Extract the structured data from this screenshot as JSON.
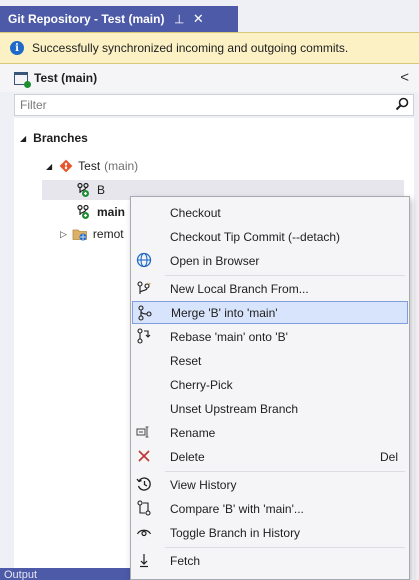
{
  "tab": {
    "title": "Git Repository - Test (main)",
    "pin": "⊣",
    "close": "✕"
  },
  "infobar": {
    "message": "Successfully synchronized incoming and outgoing commits.",
    "icon": "info-icon"
  },
  "repo": {
    "title": "Test (main)",
    "chevron": "<"
  },
  "filter": {
    "placeholder": "Filter"
  },
  "tree": {
    "branches_label": "Branches",
    "repo_node": {
      "name": "Test",
      "suffix": "(main)"
    },
    "branches": [
      {
        "name": "B"
      },
      {
        "name": "main"
      }
    ],
    "remotes_label": "remot"
  },
  "output_tab": {
    "label": "Output"
  },
  "menu": {
    "items": [
      {
        "label": "Checkout",
        "shortcut": "",
        "icon": ""
      },
      {
        "label": "Checkout Tip Commit (--detach)",
        "shortcut": "",
        "icon": ""
      },
      {
        "label": "Open in Browser",
        "shortcut": "",
        "icon": "globe-icon"
      },
      {
        "label": "New Local Branch From...",
        "shortcut": "",
        "icon": "new-branch-icon"
      },
      {
        "label": "Merge 'B' into 'main'",
        "shortcut": "",
        "icon": "merge-icon"
      },
      {
        "label": "Rebase 'main' onto 'B'",
        "shortcut": "",
        "icon": "rebase-icon"
      },
      {
        "label": "Reset",
        "shortcut": "",
        "icon": ""
      },
      {
        "label": "Cherry-Pick",
        "shortcut": "",
        "icon": ""
      },
      {
        "label": "Unset Upstream Branch",
        "shortcut": "",
        "icon": ""
      },
      {
        "label": "Rename",
        "shortcut": "",
        "icon": "rename-icon"
      },
      {
        "label": "Delete",
        "shortcut": "Del",
        "icon": "delete-icon"
      },
      {
        "label": "View History",
        "shortcut": "",
        "icon": "history-icon"
      },
      {
        "label": "Compare 'B' with 'main'...",
        "shortcut": "",
        "icon": "compare-icon"
      },
      {
        "label": "Toggle Branch in History",
        "shortcut": "",
        "icon": "eye-icon"
      },
      {
        "label": "Fetch",
        "shortcut": "",
        "icon": "fetch-icon"
      }
    ]
  },
  "colors": {
    "tab_bg": "#4d5aa7",
    "info_bg": "#fcf1c5",
    "highlight_bg": "#d8e4fb",
    "delete_red": "#c2312f",
    "git_orange": "#e8542c"
  }
}
